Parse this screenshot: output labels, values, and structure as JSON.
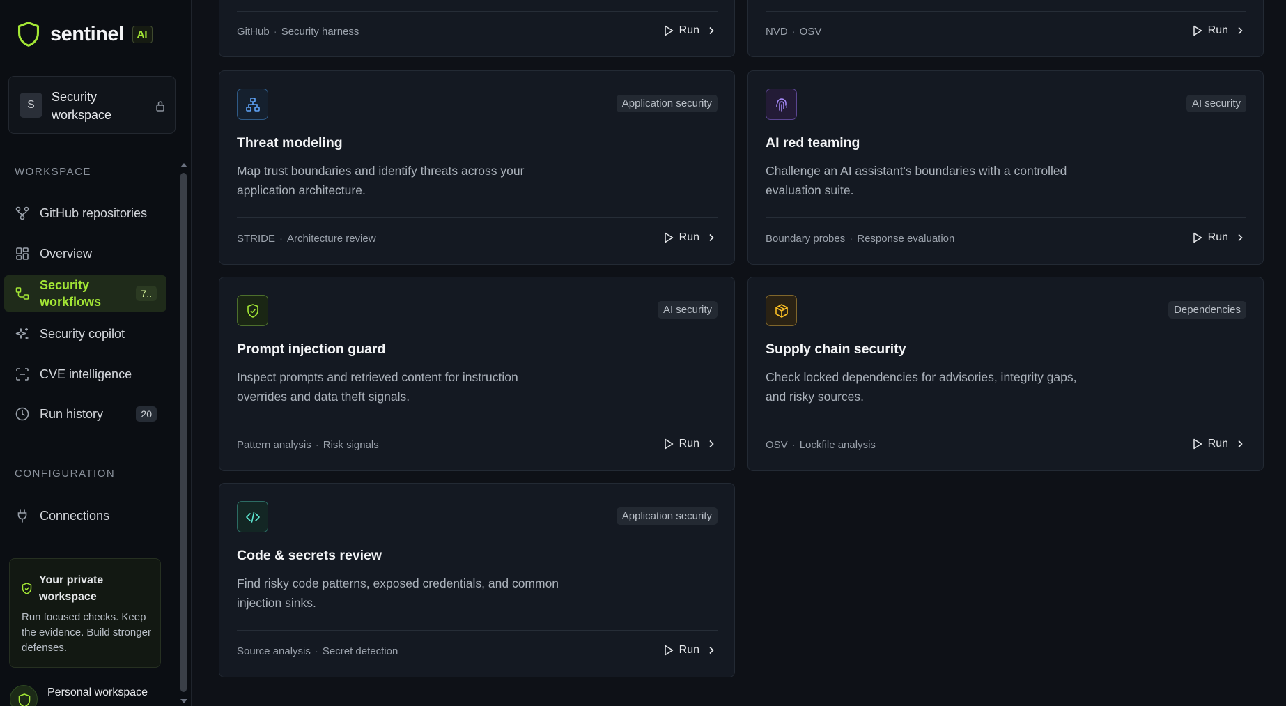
{
  "brand": {
    "name": "sentinel",
    "badge": "AI"
  },
  "workspace": {
    "avatar_letter": "S",
    "name": "Security workspace",
    "lock_icon": "lock-icon"
  },
  "nav": {
    "workspace_label": "WORKSPACE",
    "configuration_label": "CONFIGURATION",
    "items": [
      {
        "label": "GitHub repositories",
        "icon": "git-branch-icon"
      },
      {
        "label": "Overview",
        "icon": "grid-icon"
      },
      {
        "label": "Security workflows",
        "icon": "workflow-icon",
        "count": "7..",
        "active": true
      },
      {
        "label": "Security copilot",
        "icon": "sparkles-icon"
      },
      {
        "label": "CVE intelligence",
        "icon": "scan-icon"
      },
      {
        "label": "Run history",
        "icon": "clock-icon",
        "count": "20"
      }
    ],
    "config_items": [
      {
        "label": "Connections",
        "icon": "plug-icon"
      }
    ]
  },
  "private_card": {
    "title": "Your private workspace",
    "body": "Run focused checks. Keep the evidence. Build stronger defenses."
  },
  "personal": {
    "name": "Personal workspace"
  },
  "run_label": "Run",
  "colors": {
    "accent": "#a3e635",
    "background": "#0e1117",
    "card": "#141922"
  },
  "partial_cards": [
    {
      "meta": [
        "GitHub",
        "Security harness"
      ]
    },
    {
      "meta": [
        "NVD",
        "OSV"
      ]
    }
  ],
  "cards": [
    {
      "title": "Threat modeling",
      "tag": "Application security",
      "description": "Map trust boundaries and identify threats across your application architecture.",
      "meta": [
        "STRIDE",
        "Architecture review"
      ],
      "icon": "network-icon"
    },
    {
      "title": "AI red teaming",
      "tag": "AI security",
      "description": "Challenge an AI assistant's boundaries with a controlled evaluation suite.",
      "meta": [
        "Boundary probes",
        "Response evaluation"
      ],
      "icon": "fingerprint-icon"
    },
    {
      "title": "Prompt injection guard",
      "tag": "AI security",
      "description": "Inspect prompts and retrieved content for instruction overrides and data theft signals.",
      "meta": [
        "Pattern analysis",
        "Risk signals"
      ],
      "icon": "shield-check-icon"
    },
    {
      "title": "Supply chain security",
      "tag": "Dependencies",
      "description": "Check locked dependencies for advisories, integrity gaps, and risky sources.",
      "meta": [
        "OSV",
        "Lockfile analysis"
      ],
      "icon": "package-icon"
    },
    {
      "title": "Code & secrets review",
      "tag": "Application security",
      "description": "Find risky code patterns, exposed credentials, and common injection sinks.",
      "meta": [
        "Source analysis",
        "Secret detection"
      ],
      "icon": "code-icon"
    }
  ]
}
